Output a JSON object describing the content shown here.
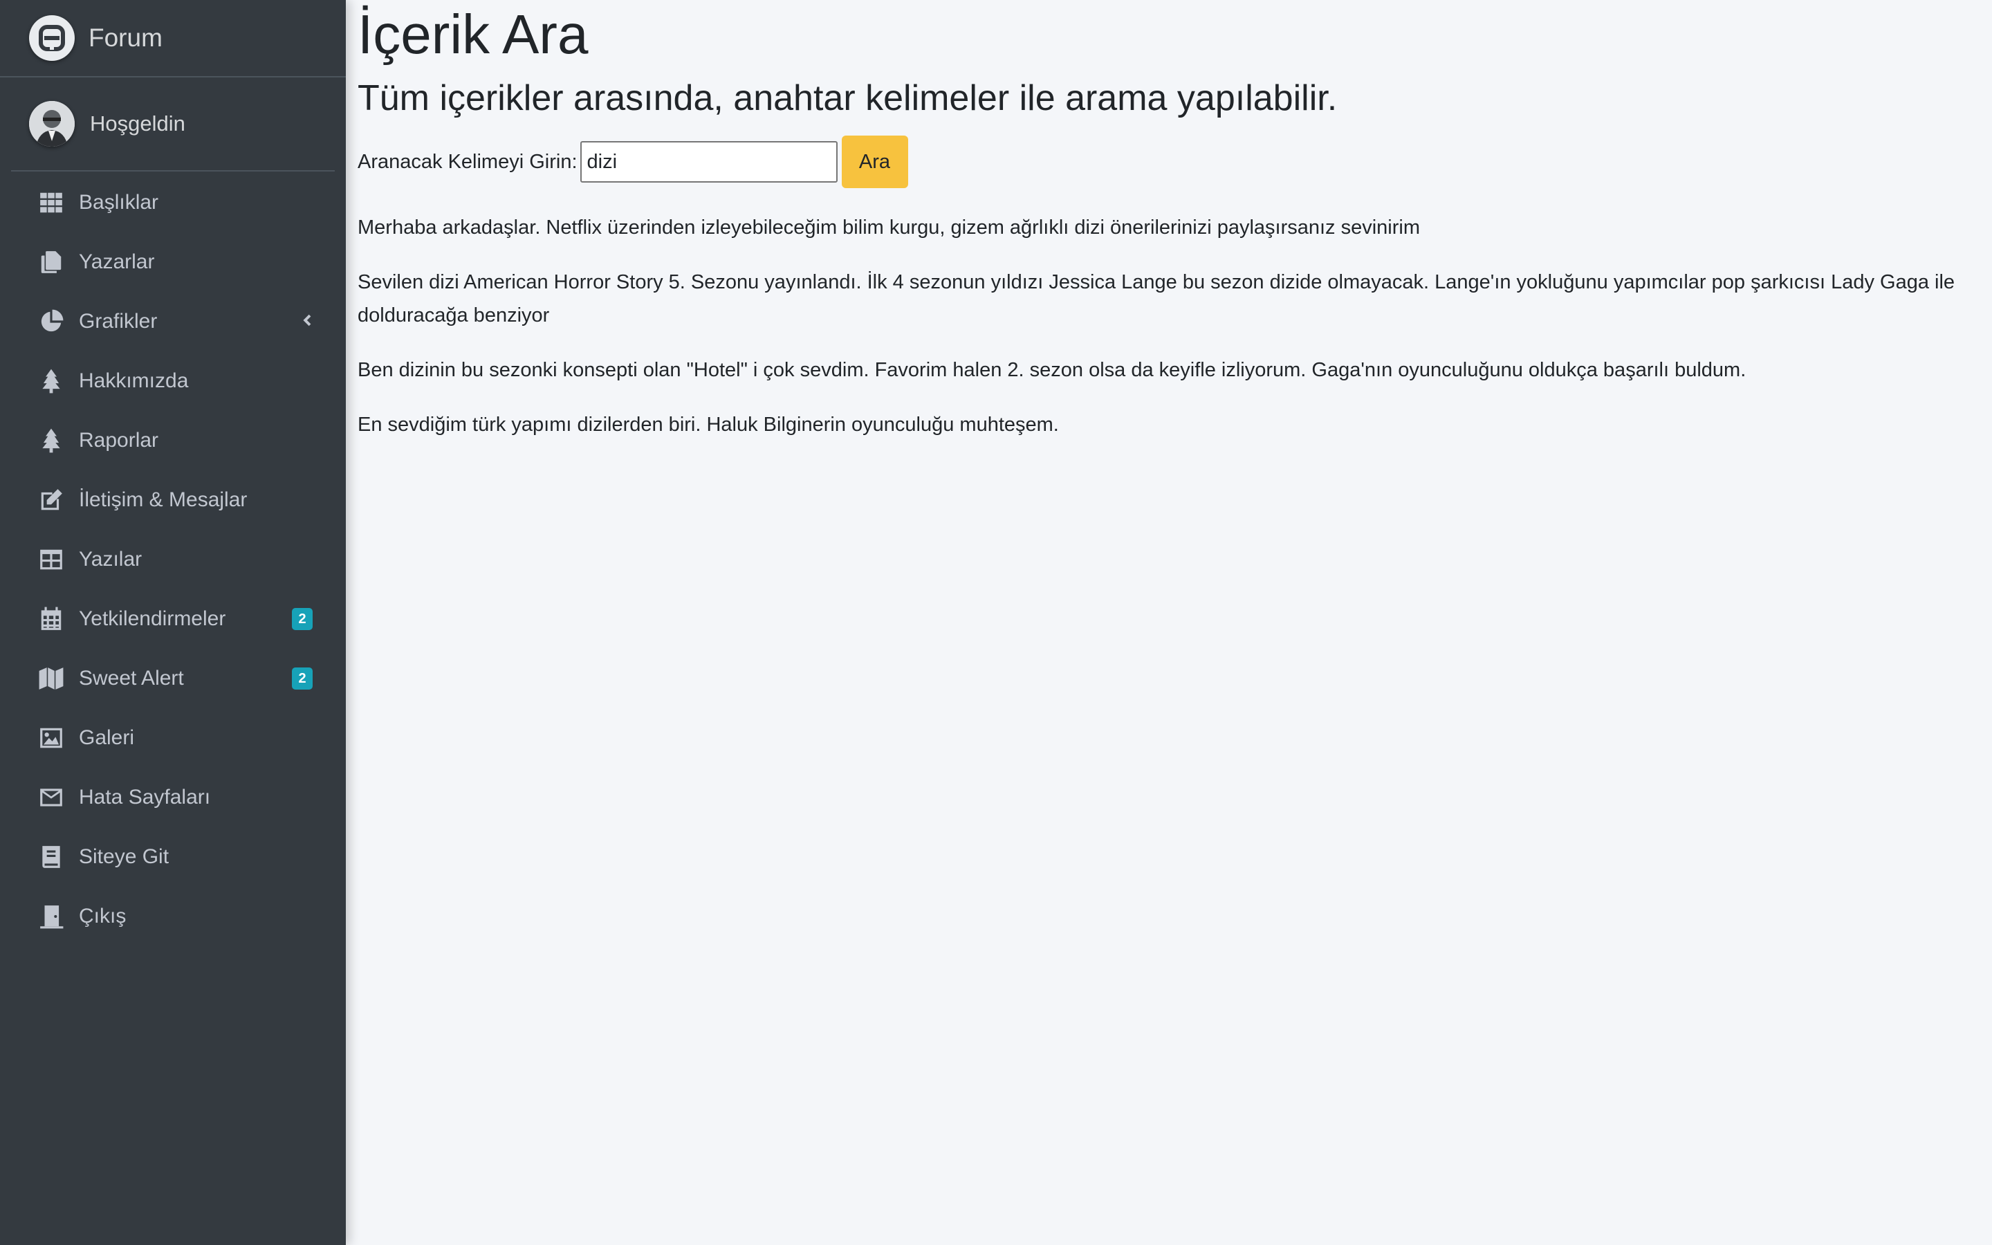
{
  "sidebar": {
    "brand": {
      "text": "Forum",
      "icon": "forum-logo-icon"
    },
    "user": {
      "name": "Hoşgeldin"
    },
    "items": [
      {
        "label": "Başlıklar",
        "icon": "grid-icon"
      },
      {
        "label": "Yazarlar",
        "icon": "copy-icon"
      },
      {
        "label": "Grafikler",
        "icon": "pie-chart-icon",
        "chevron": "chevron-left-icon"
      },
      {
        "label": "Hakkımızda",
        "icon": "tree-icon"
      },
      {
        "label": "Raporlar",
        "icon": "tree-icon"
      },
      {
        "label": "İletişim & Mesajlar",
        "icon": "edit-icon"
      },
      {
        "label": "Yazılar",
        "icon": "table-icon"
      },
      {
        "label": "Yetkilendirmeler",
        "icon": "calendar-icon",
        "badge": "2"
      },
      {
        "label": "Sweet Alert",
        "icon": "map-icon",
        "badge": "2"
      },
      {
        "label": "Galeri",
        "icon": "image-icon"
      },
      {
        "label": "Hata Sayfaları",
        "icon": "envelope-icon"
      },
      {
        "label": "Siteye Git",
        "icon": "book-icon"
      },
      {
        "label": "Çıkış",
        "icon": "door-icon"
      }
    ]
  },
  "main": {
    "title": "İçerik Ara",
    "subtitle": "Tüm içerikler arasında, anahtar kelimeler ile arama yapılabilir.",
    "search": {
      "label": "Aranacak Kelimeyi Girin:",
      "value": "dizi",
      "button_label": "Ara"
    },
    "results": [
      "Merhaba arkadaşlar. Netflix üzerinden izleyebileceğim bilim kurgu, gizem ağrlıklı dizi önerilerinizi paylaşırsanız sevinirim",
      "Sevilen dizi American Horror Story 5. Sezonu yayınlandı. İlk 4 sezonun yıldızı Jessica Lange bu sezon dizide olmayacak. Lange'ın yokluğunu yapımcılar pop şarkıcısı Lady Gaga ile dolduracağa benziyor",
      "Ben dizinin bu sezonki konsepti olan \"Hotel\" i çok sevdim. Favorim halen 2. sezon olsa da keyifle izliyorum. Gaga'nın oyunculuğunu oldukça başarılı buldum.",
      "En sevdiğim türk yapımı dizilerden biri. Haluk Bilginerin oyunculuğu muhteşem."
    ]
  },
  "colors": {
    "sidebar_bg": "#343a40",
    "content_bg": "#f4f6f9",
    "badge": "#17a2b8",
    "search_button": "#f7c23e"
  }
}
